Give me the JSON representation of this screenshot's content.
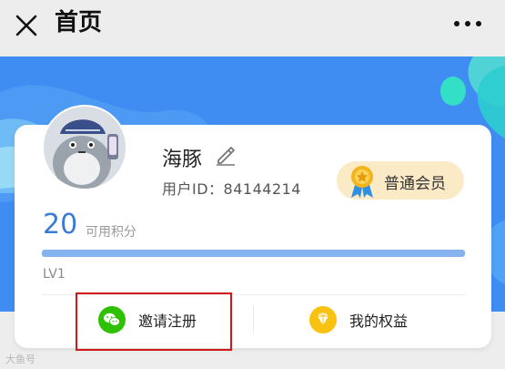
{
  "header": {
    "title": "首页"
  },
  "profile": {
    "name": "海豚",
    "user_id": "用户ID：84144214",
    "member_level": "普通会员"
  },
  "points": {
    "value": "20",
    "label": "可用积分"
  },
  "level": {
    "label": "LV1",
    "progress": 1.0
  },
  "actions": [
    {
      "label": "邀请注册",
      "icon": "wechat-icon"
    },
    {
      "label": "我的权益",
      "icon": "diamond-icon"
    }
  ],
  "watermark": "大鱼号",
  "colors": {
    "banner": "#3f8df3",
    "points": "#3a7bd5",
    "progress": "#86b3ef",
    "badge_bg": "#fbeac6",
    "wechat": "#2dc100",
    "gem": "#f9c211",
    "highlight": "#d4161c"
  }
}
